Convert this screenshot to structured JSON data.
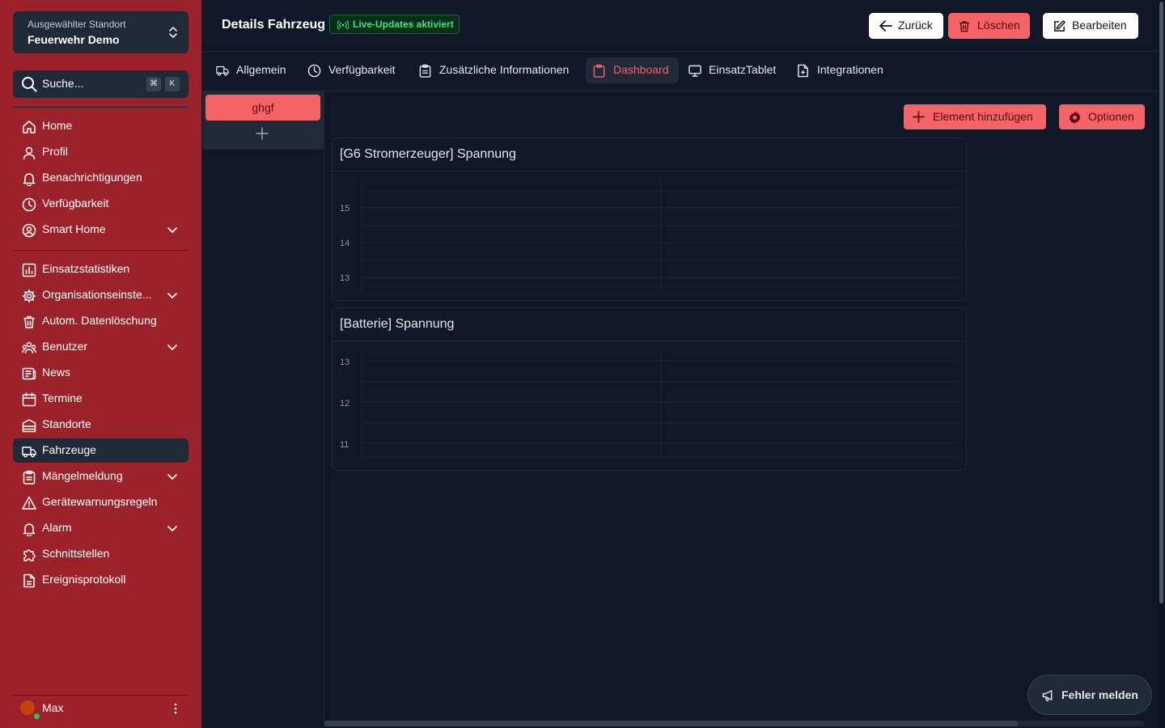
{
  "location": {
    "caption": "Ausgewählter Standort",
    "name": "Feuerwehr Demo"
  },
  "search": {
    "placeholder": "Suche...",
    "kbd_1": "⌘",
    "kbd_2": "K"
  },
  "sidebar": {
    "items": [
      {
        "label": "Home",
        "icon": "home-icon"
      },
      {
        "label": "Profil",
        "icon": "user-icon"
      },
      {
        "label": "Benachrichtigungen",
        "icon": "bell-icon"
      },
      {
        "label": "Verfügbarkeit",
        "icon": "clock-icon"
      },
      {
        "label": "Smart Home",
        "icon": "user-circle-icon"
      },
      {
        "label": "Einsatzstatistiken",
        "icon": "chart-icon"
      },
      {
        "label": "Organisationseinste...",
        "icon": "gear-icon"
      },
      {
        "label": "Autom. Datenlöschung",
        "icon": "trash-icon"
      },
      {
        "label": "Benutzer",
        "icon": "users-icon"
      },
      {
        "label": "News",
        "icon": "newspaper-icon"
      },
      {
        "label": "Termine",
        "icon": "calendar-icon"
      },
      {
        "label": "Standorte",
        "icon": "building-icon"
      },
      {
        "label": "Fahrzeuge",
        "icon": "truck-icon"
      },
      {
        "label": "Mängelmeldung",
        "icon": "clipboard-icon"
      },
      {
        "label": "Gerätewarnungsregeln",
        "icon": "warning-icon"
      },
      {
        "label": "Alarm",
        "icon": "bell-icon"
      },
      {
        "label": "Schnittstellen",
        "icon": "puzzle-icon"
      },
      {
        "label": "Ereignisprotokoll",
        "icon": "document-icon"
      }
    ]
  },
  "user": {
    "name": "Max"
  },
  "header": {
    "title": "Details Fahrzeug",
    "live_badge": "Live-Updates aktiviert",
    "back_label": "Zurück",
    "delete_label": "Löschen",
    "edit_label": "Bearbeiten"
  },
  "tabs": [
    {
      "label": "Allgemein",
      "icon": "truck-icon"
    },
    {
      "label": "Verfügbarkeit",
      "icon": "clock-icon"
    },
    {
      "label": "Zusätzliche Informationen",
      "icon": "clipboard-icon"
    },
    {
      "label": "Dashboard",
      "icon": "clipboard-icon",
      "active": true
    },
    {
      "label": "EinsatzTablet",
      "icon": "monitor-icon"
    },
    {
      "label": "Integrationen",
      "icon": "document-plus-icon"
    }
  ],
  "dashboards": {
    "items": [
      "ghgf"
    ]
  },
  "toolbar": {
    "add_label": "Element hinzufügen",
    "options_label": "Optionen"
  },
  "cards": [
    {
      "title": "[G6 Stromerzeuger] Spannung",
      "ticks": [
        "15",
        "14",
        "13"
      ]
    },
    {
      "title": "[Batterie] Spannung",
      "ticks": [
        "13",
        "12",
        "11"
      ]
    }
  ],
  "feedback": {
    "label": "Fehler melden"
  },
  "colors": {
    "sidebar": "#9b222b",
    "accent": "#f46466",
    "background": "#0f1729",
    "live": "#4ade80"
  }
}
